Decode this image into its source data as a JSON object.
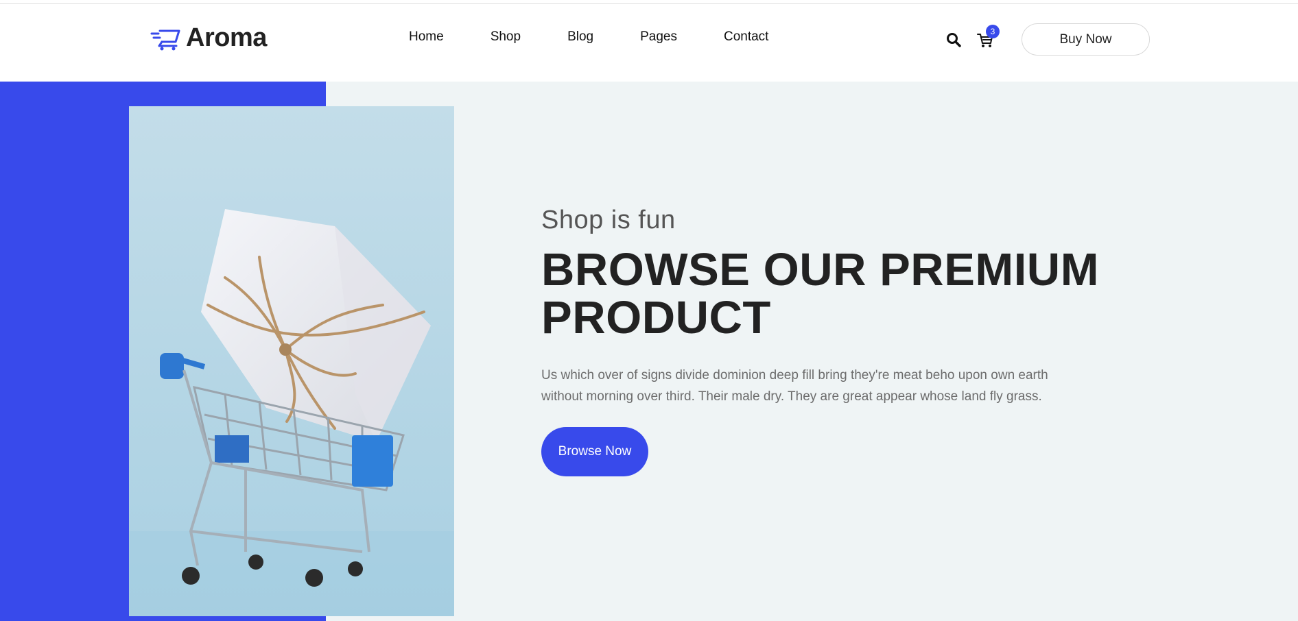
{
  "colors": {
    "accent": "#384aeb",
    "hero_bg": "#eff4f5",
    "text_dark": "#222222",
    "text_muted": "#6c6c6c"
  },
  "brand": {
    "name": "Aroma",
    "icon": "shopping-cart-logo-icon"
  },
  "nav": {
    "items": [
      {
        "label": "Home"
      },
      {
        "label": "Shop"
      },
      {
        "label": "Blog"
      },
      {
        "label": "Pages"
      },
      {
        "label": "Contact"
      }
    ]
  },
  "header_actions": {
    "search_icon": "search-icon",
    "cart_icon": "cart-icon",
    "cart_count": "3",
    "buy_now_label": "Buy Now"
  },
  "hero": {
    "subtitle": "Shop is fun",
    "title": "BROWSE OUR PREMIUM PRODUCT",
    "description": "Us which over of signs divide dominion deep fill bring they're meat beho upon own earth without morning over third. Their male dry. They are great appear whose land fly grass.",
    "button_label": "Browse Now",
    "image": "shopping-cart-with-gift-box"
  }
}
